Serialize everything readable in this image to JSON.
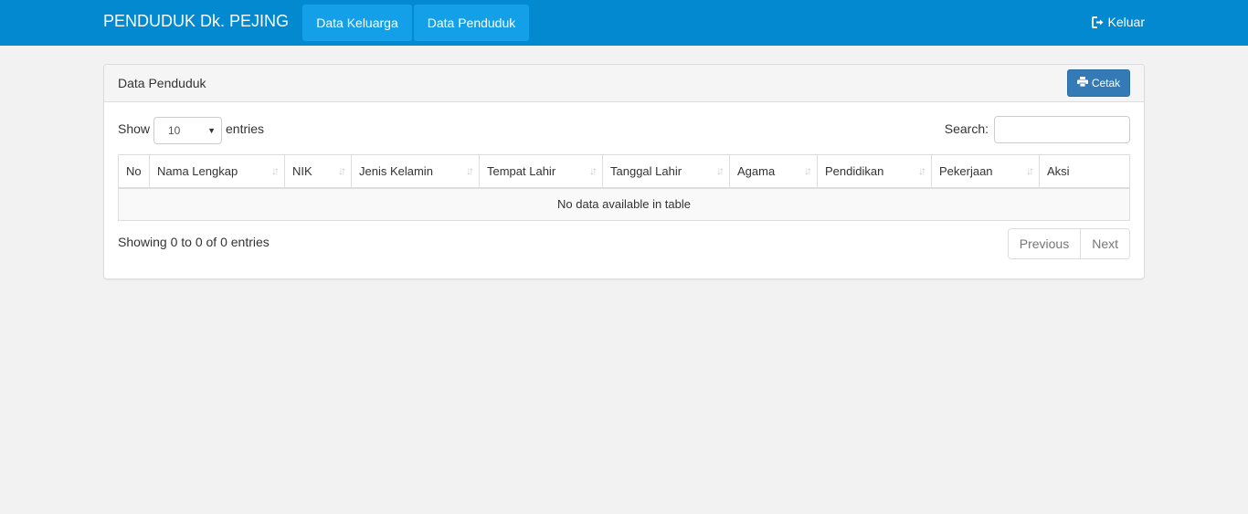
{
  "navbar": {
    "brand": "PENDUDUK Dk. PEJING",
    "items": [
      {
        "label": "Data Keluarga"
      },
      {
        "label": "Data Penduduk"
      }
    ],
    "logout_label": "Keluar"
  },
  "panel": {
    "title": "Data Penduduk",
    "print_label": "Cetak"
  },
  "table_controls": {
    "show_label": "Show",
    "entries_value": "10",
    "entries_label": "entries",
    "search_label": "Search:",
    "search_value": ""
  },
  "table": {
    "columns": [
      "No",
      "Nama Lengkap",
      "NIK",
      "Jenis Kelamin",
      "Tempat Lahir",
      "Tanggal Lahir",
      "Agama",
      "Pendidikan",
      "Pekerjaan",
      "Aksi"
    ],
    "empty_message": "No data available in table"
  },
  "footer": {
    "info": "Showing 0 to 0 of 0 entries",
    "previous_label": "Previous",
    "next_label": "Next"
  },
  "colors": {
    "navbar": "#0289cf",
    "nav_active": "#14a0e8",
    "primary_button": "#337ab7"
  },
  "icons": {
    "logout": "sign-out-icon",
    "print": "print-icon",
    "sort": "sort-icon"
  }
}
